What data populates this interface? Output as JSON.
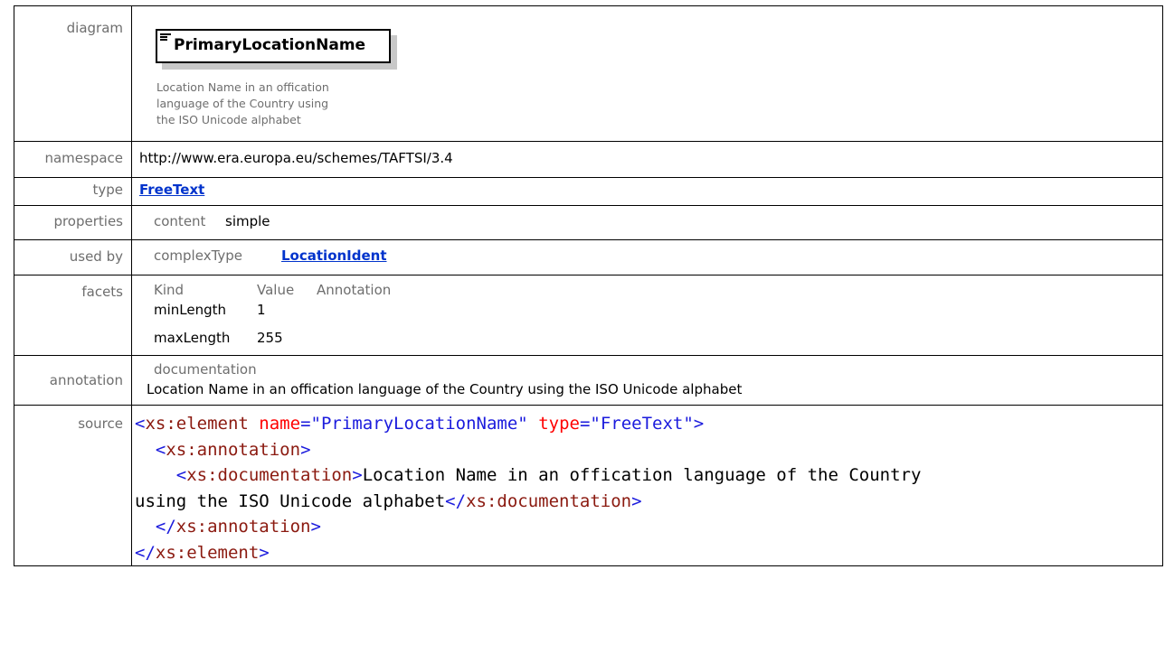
{
  "labels": {
    "diagram": "diagram",
    "namespace": "namespace",
    "type": "type",
    "properties": "properties",
    "used_by": "used by",
    "facets": "facets",
    "annotation": "annotation",
    "source": "source"
  },
  "diagram": {
    "element_name": "PrimaryLocationName",
    "description_lines": [
      "Location Name in an offication",
      "language of the Country using",
      "the ISO Unicode alphabet"
    ]
  },
  "namespace": "http://www.era.europa.eu/schemes/TAFTSI/3.4",
  "type": "FreeText",
  "properties": {
    "key": "content",
    "value": "simple"
  },
  "used_by": {
    "key": "complexType",
    "value": "LocationIdent"
  },
  "facets": {
    "headers": [
      "Kind",
      "Value",
      "Annotation"
    ],
    "rows": [
      {
        "kind": "minLength",
        "value": "1"
      },
      {
        "kind": "maxLength",
        "value": "255"
      }
    ]
  },
  "annotation": {
    "key": "documentation",
    "text": "Location Name in an offication language of the Country using the ISO Unicode alphabet"
  },
  "source": {
    "line1": {
      "open": "<",
      "tag": "xs:element",
      "attr1_name": "name",
      "eq": "=",
      "attr1_value": "\"PrimaryLocationName\"",
      "attr2_name": "type",
      "attr2_value": "\"FreeText\"",
      "close": ">"
    },
    "line2_tag": "xs:annotation",
    "line3_tag": "xs:documentation",
    "line3_text": "Location Name in an offication language of the Country",
    "line4_text": "using the ISO Unicode alphabet",
    "line4_close_tag": "xs:documentation",
    "line5_close_tag": "xs:annotation",
    "line6_close_tag": "xs:element"
  }
}
